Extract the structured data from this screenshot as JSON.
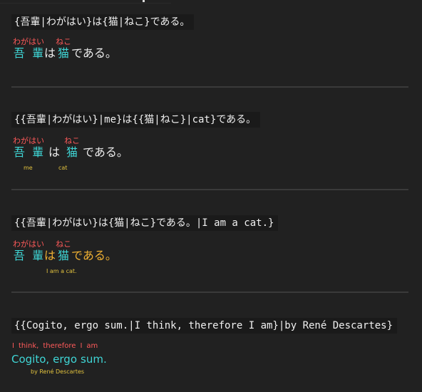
{
  "examples": [
    {
      "code": "{吾輩|わがはい}は{猫|ねこ}である。",
      "furigana": [
        "わがはい",
        "ねこ"
      ],
      "base": [
        "吾",
        "輩",
        "は",
        "猫",
        "である。"
      ]
    },
    {
      "code": "{{吾輩|わがはい}|me}は{{猫|ねこ}|cat}である。",
      "furigana": [
        "わがはい",
        "ねこ"
      ],
      "base": [
        "吾",
        "輩",
        "は",
        "猫",
        "である。"
      ],
      "translations": [
        "me",
        "cat"
      ]
    },
    {
      "code": "{{吾輩|わがはい}は{猫|ねこ}である。|I am a cat.}",
      "furigana": [
        "わがはい",
        "ねこ"
      ],
      "base": [
        "吾",
        "輩",
        "は",
        "猫",
        "である。"
      ],
      "translation": "I am a cat."
    },
    {
      "code": "{{Cogito, ergo sum.|I think, therefore I am}|by René Descartes}",
      "gloss": [
        "I",
        "think,",
        "therefore",
        "I",
        "am"
      ],
      "base": [
        "Cogito,",
        "ergo",
        "sum."
      ],
      "attribution": "by René Descartes"
    }
  ],
  "colors": {
    "background": "#212121",
    "furigana": "#ff5a5a",
    "base_kanji": "#3fd6d6",
    "translation": "#e2c23e",
    "sentence_highlight": "#f2b233"
  }
}
